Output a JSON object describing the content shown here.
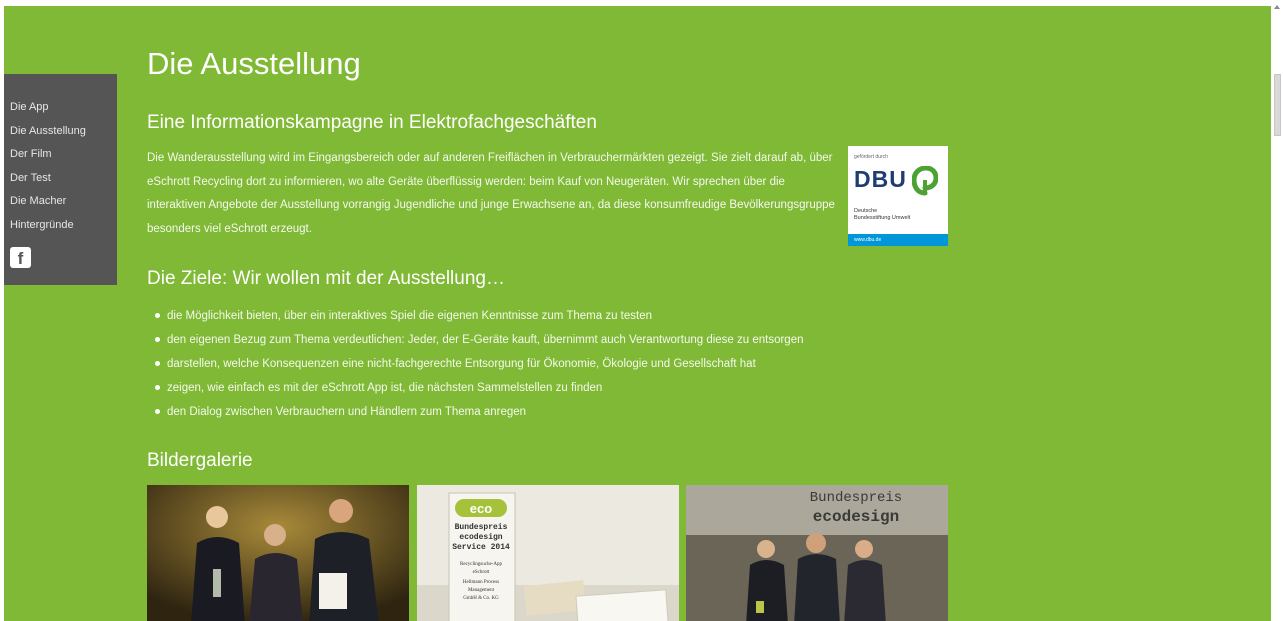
{
  "nav": {
    "items": [
      {
        "label": "Die App"
      },
      {
        "label": "Die Ausstellung"
      },
      {
        "label": "Der Film"
      },
      {
        "label": "Der Test"
      },
      {
        "label": "Die Macher"
      },
      {
        "label": "Hintergründe"
      }
    ],
    "facebook_icon": "facebook-icon",
    "facebook_glyph": "f"
  },
  "page": {
    "title": "Die Ausstellung",
    "subtitle": "Eine Informationskampagne in Elektrofachgeschäften",
    "intro": "Die Wanderausstellung wird im Eingangsbereich oder auf anderen Freiflächen in Verbrauchermärkten gezeigt. Sie zielt darauf ab, über eSchrott Recycling dort zu informieren, wo alte Geräte überflüssig werden: beim Kauf von Neugeräten. Wir sprechen über die interaktiven Angebote der Ausstellung vorrangig Jugendliche und junge Erwachsene an, da diese konsumfreudige Bevölkerungsgruppe besonders viel eSchrott erzeugt.",
    "goals_heading": "Die Ziele: Wir wollen mit der Ausstellung…",
    "goals": [
      "die Möglichkeit bieten, über ein interaktives Spiel die eigenen Kenntnisse zum Thema zu testen",
      "den eigenen Bezug zum Thema verdeutlichen: Jeder, der E-Geräte kauft, übernimmt auch Verantwortung diese zu entsorgen",
      "darstellen, welche Konsequenzen eine nicht-fachgerechte Entsorgung für Ökonomie, Ökologie und Gesellschaft hat",
      "zeigen, wie einfach es mit der eSchrott App ist, die nächsten Sammelstellen zu finden",
      "den Dialog zwischen Verbrauchern und Händlern zum Thema anregen"
    ],
    "gallery_heading": "Bildergalerie"
  },
  "dbu_logo": {
    "small_text": "gefördert durch",
    "letters": "DBU",
    "name_line1": "Deutsche",
    "name_line2": "Bundesstiftung Umwelt",
    "url": "www.dbu.de"
  },
  "gallery": {
    "photo2_texts": {
      "eco": "eco",
      "line1": "Bundespreis",
      "line2": "ecodesign",
      "line3": "Service 2014",
      "line4": "Recyclingsuche-App",
      "line5": "eSchrott",
      "line6": "Hellmann Process",
      "line7": "Management",
      "line8": "GmbH & Co. KG"
    },
    "photo3_texts": {
      "line1": "Bundespreis",
      "line2": "ecodesign"
    }
  },
  "colors": {
    "background": "#80b935",
    "sidebar": "#555555",
    "text": "#ffffff",
    "dbu_blue": "#1f3c73",
    "dbu_green": "#4ca233",
    "dbu_bar": "#0097d9"
  }
}
